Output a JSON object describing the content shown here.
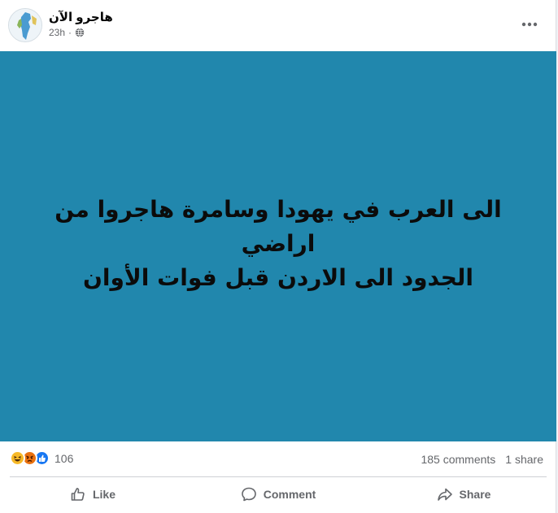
{
  "post": {
    "page_name": "هاجرو الآن",
    "timestamp": "23h",
    "separator": "·",
    "privacy_icon": "globe-icon",
    "more_icon": "more-options-icon",
    "image_text_line1": "الى العرب في يهودا وسامرة هاجروا من اراضي",
    "image_text_line2": "الجدود الى الاردن قبل فوات الأوان",
    "image_background": "#2187ad"
  },
  "stats": {
    "reaction_icons": [
      "haha-icon",
      "angry-icon",
      "like-reaction-icon"
    ],
    "reaction_count": "106",
    "comments": "185 comments",
    "shares": "1 share"
  },
  "actions": {
    "like_label": "Like",
    "comment_label": "Comment",
    "share_label": "Share"
  },
  "colors": {
    "text_secondary": "#65676b",
    "like_blue": "#1877f2",
    "haha_yellow": "#f7b928",
    "angry_red": "#e9710f"
  }
}
